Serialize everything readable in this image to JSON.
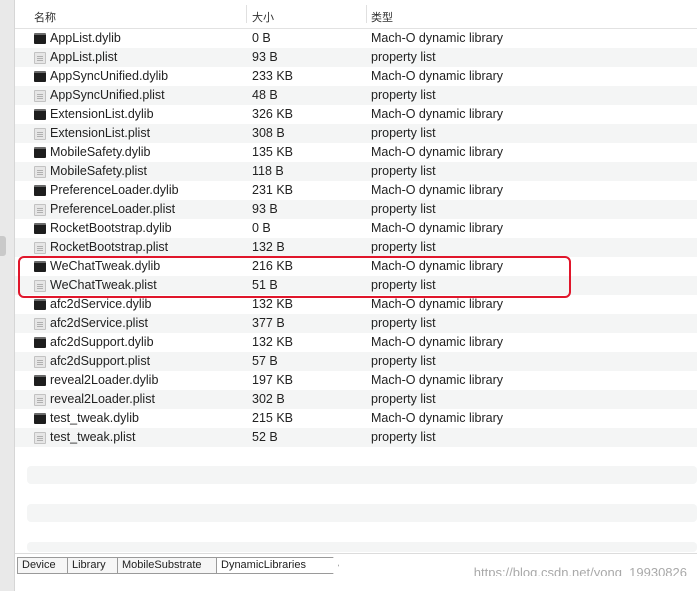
{
  "header": {
    "name_label": "名称",
    "size_label": "大小",
    "kind_label": "类型"
  },
  "files": [
    {
      "name": "AppList.dylib",
      "size": "0 B",
      "kind": "Mach-O dynamic library",
      "icon": "executable-file-icon"
    },
    {
      "name": "AppList.plist",
      "size": "93 B",
      "kind": "property list",
      "icon": "document-file-icon"
    },
    {
      "name": "AppSyncUnified.dylib",
      "size": "233 KB",
      "kind": "Mach-O dynamic library",
      "icon": "executable-file-icon"
    },
    {
      "name": "AppSyncUnified.plist",
      "size": "48 B",
      "kind": "property list",
      "icon": "document-file-icon"
    },
    {
      "name": "ExtensionList.dylib",
      "size": "326 KB",
      "kind": "Mach-O dynamic library",
      "icon": "executable-file-icon"
    },
    {
      "name": "ExtensionList.plist",
      "size": "308 B",
      "kind": "property list",
      "icon": "document-file-icon"
    },
    {
      "name": "MobileSafety.dylib",
      "size": "135 KB",
      "kind": "Mach-O dynamic library",
      "icon": "executable-file-icon"
    },
    {
      "name": "MobileSafety.plist",
      "size": "118 B",
      "kind": "property list",
      "icon": "document-file-icon"
    },
    {
      "name": "PreferenceLoader.dylib",
      "size": "231 KB",
      "kind": "Mach-O dynamic library",
      "icon": "executable-file-icon"
    },
    {
      "name": "PreferenceLoader.plist",
      "size": "93 B",
      "kind": "property list",
      "icon": "document-file-icon"
    },
    {
      "name": "RocketBootstrap.dylib",
      "size": "0 B",
      "kind": "Mach-O dynamic library",
      "icon": "executable-file-icon"
    },
    {
      "name": "RocketBootstrap.plist",
      "size": "132 B",
      "kind": "property list",
      "icon": "document-file-icon"
    },
    {
      "name": "WeChatTweak.dylib",
      "size": "216 KB",
      "kind": "Mach-O dynamic library",
      "icon": "executable-file-icon"
    },
    {
      "name": "WeChatTweak.plist",
      "size": "51 B",
      "kind": "property list",
      "icon": "document-file-icon"
    },
    {
      "name": "afc2dService.dylib",
      "size": "132 KB",
      "kind": "Mach-O dynamic library",
      "icon": "executable-file-icon"
    },
    {
      "name": "afc2dService.plist",
      "size": "377 B",
      "kind": "property list",
      "icon": "document-file-icon"
    },
    {
      "name": "afc2dSupport.dylib",
      "size": "132 KB",
      "kind": "Mach-O dynamic library",
      "icon": "executable-file-icon"
    },
    {
      "name": "afc2dSupport.plist",
      "size": "57 B",
      "kind": "property list",
      "icon": "document-file-icon"
    },
    {
      "name": "reveal2Loader.dylib",
      "size": "197 KB",
      "kind": "Mach-O dynamic library",
      "icon": "executable-file-icon"
    },
    {
      "name": "reveal2Loader.plist",
      "size": "302 B",
      "kind": "property list",
      "icon": "document-file-icon"
    },
    {
      "name": "test_tweak.dylib",
      "size": "215 KB",
      "kind": "Mach-O dynamic library",
      "icon": "executable-file-icon"
    },
    {
      "name": "test_tweak.plist",
      "size": "52 B",
      "kind": "property list",
      "icon": "document-file-icon"
    }
  ],
  "path": [
    "Device",
    "Library",
    "MobileSubstrate",
    "DynamicLibraries"
  ],
  "watermark": "https://blog.csdn.net/yong_19930826",
  "colors": {
    "highlight": "#e0162b",
    "row_alt": "#f4f5f5"
  }
}
